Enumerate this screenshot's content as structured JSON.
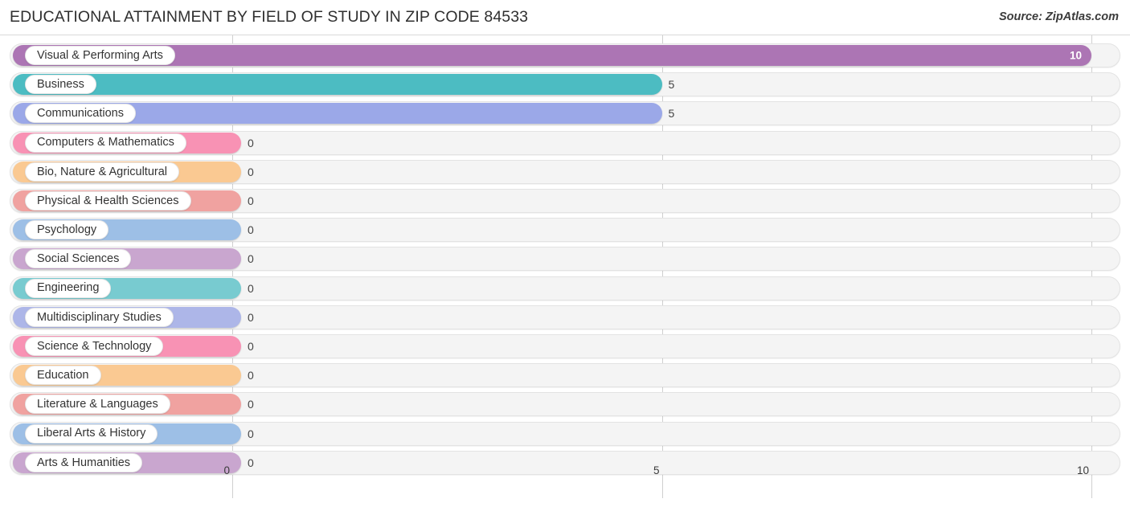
{
  "header": {
    "title": "EDUCATIONAL ATTAINMENT BY FIELD OF STUDY IN ZIP CODE 84533",
    "source": "Source: ZipAtlas.com"
  },
  "chart_data": {
    "type": "bar",
    "orientation": "horizontal",
    "title": "EDUCATIONAL ATTAINMENT BY FIELD OF STUDY IN ZIP CODE 84533",
    "xlabel": "",
    "ylabel": "",
    "xlim": [
      0,
      10
    ],
    "xticks": [
      "0",
      "5",
      "10"
    ],
    "xtick_values": [
      0,
      5,
      10
    ],
    "grid": true,
    "legend": false,
    "categories": [
      "Visual & Performing Arts",
      "Business",
      "Communications",
      "Computers & Mathematics",
      "Bio, Nature & Agricultural",
      "Physical & Health Sciences",
      "Psychology",
      "Social Sciences",
      "Engineering",
      "Multidisciplinary Studies",
      "Science & Technology",
      "Education",
      "Literature & Languages",
      "Liberal Arts & History",
      "Arts & Humanities"
    ],
    "values": [
      10,
      5,
      5,
      0,
      0,
      0,
      0,
      0,
      0,
      0,
      0,
      0,
      0,
      0,
      0
    ],
    "value_labels": [
      "10",
      "5",
      "5",
      "0",
      "0",
      "0",
      "0",
      "0",
      "0",
      "0",
      "0",
      "0",
      "0",
      "0",
      "0"
    ],
    "colors": [
      "#ac75b4",
      "#4cbcc2",
      "#9ba8e8",
      "#f892b4",
      "#fac992",
      "#f0a2a0",
      "#9dbfe6",
      "#c9a6cf",
      "#78cbd0",
      "#adb6e8",
      "#f892b4",
      "#fac992",
      "#f0a2a0",
      "#9dbfe6",
      "#c9a6cf"
    ]
  }
}
